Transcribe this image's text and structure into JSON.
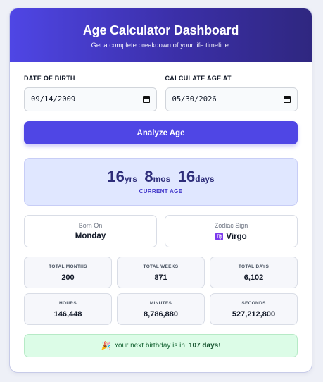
{
  "header": {
    "title": "Age Calculator Dashboard",
    "subtitle": "Get a complete breakdown of your life timeline."
  },
  "inputs": {
    "dob_label": "DATE OF BIRTH",
    "dob_value": "09/14/2009",
    "calc_label": "CALCULATE AGE AT",
    "calc_value": "05/30/2026"
  },
  "analyze_button": "Analyze Age",
  "current_age": {
    "years": "16",
    "years_unit": "yrs",
    "months": "8",
    "months_unit": "mos",
    "days": "16",
    "days_unit": "days",
    "caption": "CURRENT AGE"
  },
  "born_on": {
    "label": "Born On",
    "value": "Monday"
  },
  "zodiac": {
    "label": "Zodiac Sign",
    "value": "Virgo",
    "icon": "virgo-icon"
  },
  "stats": [
    {
      "label": "TOTAL MONTHS",
      "value": "200"
    },
    {
      "label": "TOTAL WEEKS",
      "value": "871"
    },
    {
      "label": "TOTAL DAYS",
      "value": "6,102"
    },
    {
      "label": "HOURS",
      "value": "146,448"
    },
    {
      "label": "MINUTES",
      "value": "8,786,880"
    },
    {
      "label": "SECONDS",
      "value": "527,212,800"
    }
  ],
  "birthday": {
    "prefix": "Your next birthday is in",
    "days": "107 days!",
    "icon": "party-popper-icon"
  },
  "colors": {
    "accent": "#4f46e5",
    "header_dark": "#2f2780",
    "age_bg": "#e0e7ff",
    "birthday_bg": "#dcfce7"
  }
}
